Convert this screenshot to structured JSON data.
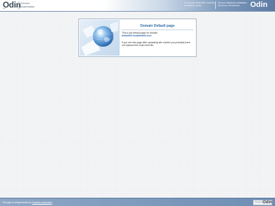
{
  "header": {
    "logo_text": "Odin",
    "logo_subtitle": "Odin",
    "product_line1": "Service",
    "product_line2": "Automation",
    "copyright_line1": "© Copyright 1999-2015, Parallels",
    "copyright_line2": "IP Holdings GmbH.",
    "discover_prefix": "Discover",
    "discover_bold": "Virtuozzo containers",
    "discover_suffix": ",",
    "discover_line2": "OS Server Virtualization",
    "right_logo": "Odin"
  },
  "panel": {
    "title": "Domain Default page",
    "line1": "This is the default page for domain",
    "domain": "defaultSS.localdefault.com",
    "body": "If you see this page after uploading site content you probably have not replaced the index.html file."
  },
  "footer": {
    "text_prefix": "This page is autogenerated by",
    "link_text": "Parallels Automation",
    "powered_label": "Powered by",
    "powered_logo": "Odin"
  },
  "colors": {
    "accent": "#2f6aa6",
    "header_gradient_end": "#5c7aa3",
    "footer": "#7a96ba"
  }
}
